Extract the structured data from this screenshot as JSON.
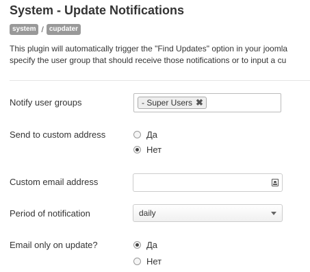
{
  "header": {
    "title": "System - Update Notifications",
    "breadcrumbs": [
      "system",
      "cupdater"
    ],
    "separator": "/"
  },
  "description": {
    "line1": "This plugin will automatically trigger the \"Find Updates\" option in your joomla",
    "line2": "specify the user group that should receive those notifications or to input a cu"
  },
  "fields": {
    "notify_groups": {
      "label": "Notify user groups",
      "selected": [
        "- Super Users"
      ],
      "remove_glyph": "✖"
    },
    "custom_address": {
      "label": "Send to custom address",
      "options": [
        {
          "label": "Да",
          "checked": false
        },
        {
          "label": "Нет",
          "checked": true
        }
      ]
    },
    "custom_email": {
      "label": "Custom email address",
      "value": "",
      "icon": "contact-card-icon"
    },
    "period": {
      "label": "Period of notification",
      "value": "daily"
    },
    "email_only_update": {
      "label": "Email only on update?",
      "options": [
        {
          "label": "Да",
          "checked": true
        },
        {
          "label": "Нет",
          "checked": false
        }
      ]
    }
  }
}
